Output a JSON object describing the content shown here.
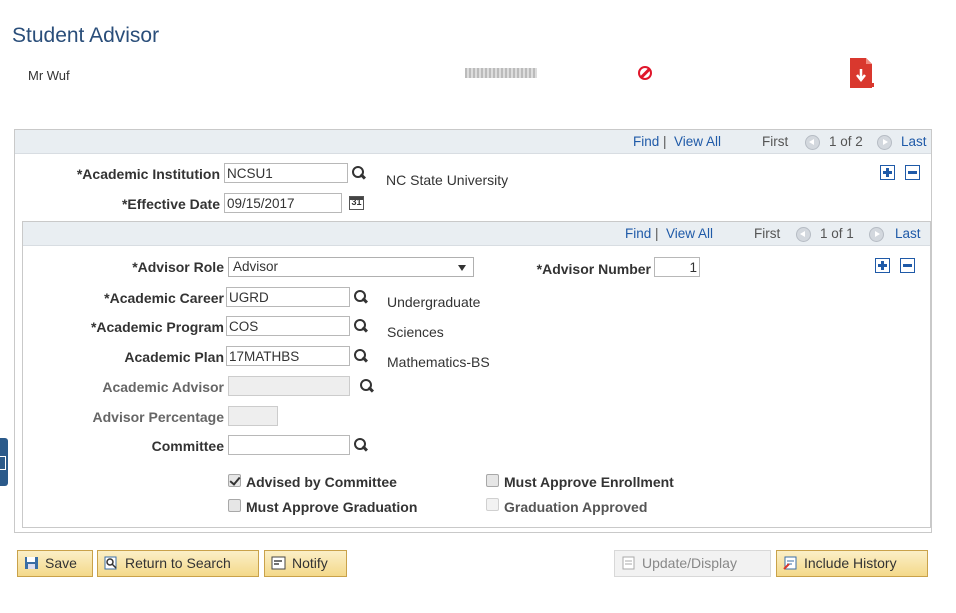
{
  "page_title": "Student Advisor",
  "student": {
    "name": "Mr Wuf"
  },
  "icons": {
    "stop": "no-entry-icon",
    "pdf": "pdf-download-icon",
    "lookup": "magnifier-icon",
    "calendar": "calendar-icon"
  },
  "colors": {
    "title": "#2a4e7a",
    "link": "#1f5aa8",
    "alert": "#e0162b",
    "button": "#f4d98a"
  },
  "outer_nav": {
    "find": "Find",
    "sep": "|",
    "view_all": "View All",
    "first": "First",
    "position": "1 of 2",
    "last": "Last"
  },
  "inner_nav": {
    "find": "Find",
    "sep": "|",
    "view_all": "View All",
    "first": "First",
    "position": "1 of 1",
    "last": "Last"
  },
  "fields": {
    "institution": {
      "label": "*Academic Institution",
      "value": "NCSU1",
      "description": "NC State University"
    },
    "effective_date": {
      "label": "*Effective Date",
      "value": "09/15/2017",
      "cal_text": "31"
    },
    "advisor_role": {
      "label": "*Advisor Role",
      "value": "Advisor"
    },
    "advisor_number": {
      "label": "*Advisor Number",
      "value": "1"
    },
    "career": {
      "label": "*Academic Career",
      "value": "UGRD",
      "description": "Undergraduate"
    },
    "program": {
      "label": "*Academic Program",
      "value": "COS",
      "description": "Sciences"
    },
    "plan": {
      "label": "Academic Plan",
      "value": "17MATHBS",
      "description": "Mathematics-BS"
    },
    "advisor": {
      "label": "Academic Advisor",
      "value": ""
    },
    "percentage": {
      "label": "Advisor Percentage",
      "value": ""
    },
    "committee": {
      "label": "Committee",
      "value": ""
    }
  },
  "checkboxes": {
    "advised_by_committee": {
      "label": "Advised by Committee",
      "checked": true
    },
    "must_approve_enrollment": {
      "label": "Must Approve Enrollment",
      "checked": false
    },
    "must_approve_graduation": {
      "label": "Must Approve Graduation",
      "checked": false
    },
    "graduation_approved": {
      "label": "Graduation Approved",
      "checked": false,
      "disabled": true
    }
  },
  "buttons": {
    "save": "Save",
    "return_to_search": "Return to Search",
    "notify": "Notify",
    "update_display": "Update/Display",
    "include_history": "Include History"
  }
}
